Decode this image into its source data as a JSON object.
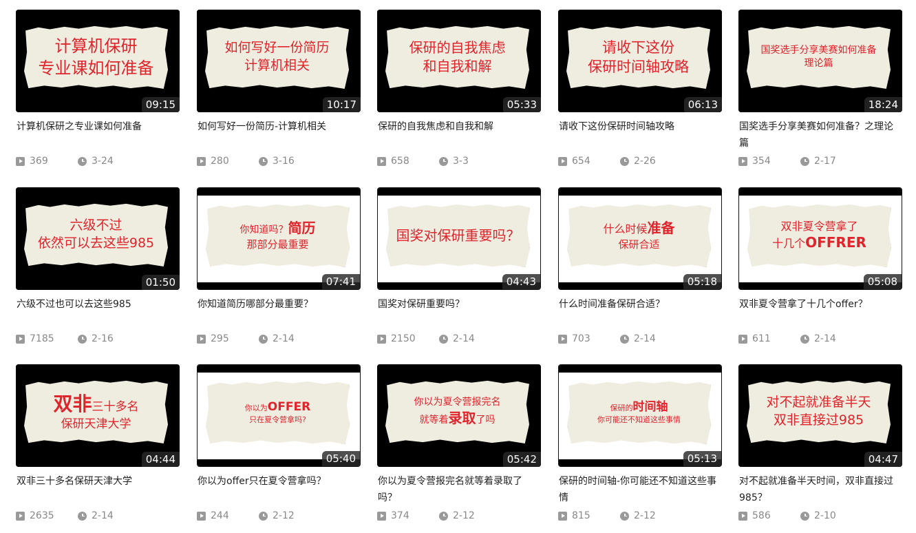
{
  "videos": [
    {
      "title": "计算机保研之专业课如何准备",
      "duration": "09:15",
      "views": "369",
      "date": "3-24",
      "thumb_lines": [
        {
          "a": "计算机保研"
        },
        {
          "a": "专业课如何准备"
        }
      ]
    },
    {
      "title": "如何写好一份简历-计算机相关",
      "duration": "10:17",
      "views": "280",
      "date": "3-16",
      "thumb_lines": [
        {
          "a": "如何写好一份简历"
        },
        {
          "a": "计算机相关"
        }
      ]
    },
    {
      "title": "保研的自我焦虑和自我和解",
      "duration": "05:33",
      "views": "658",
      "date": "3-3",
      "thumb_lines": [
        {
          "a": "保研的自我焦虑"
        },
        {
          "a": "和自我和解"
        }
      ]
    },
    {
      "title": "请收下这份保研时间轴攻略",
      "duration": "06:13",
      "views": "654",
      "date": "2-26",
      "thumb_lines": [
        {
          "a": "请收下这份"
        },
        {
          "a": "保研时间轴攻略"
        }
      ]
    },
    {
      "title": "国奖选手分享美赛如何准备？之理论篇",
      "duration": "18:24",
      "views": "354",
      "date": "2-17",
      "thumb_lines": [
        {
          "a": "国奖选手分享美赛如何准备"
        },
        {
          "a": "理论篇"
        }
      ]
    },
    {
      "title": "六级不过也可以去这些985",
      "duration": "01:50",
      "views": "7185",
      "date": "2-16",
      "thumb_lines": [
        {
          "a": "六级不过"
        },
        {
          "a": "依然可以去这些985"
        }
      ]
    },
    {
      "title": "你知道简历哪部分最重要？",
      "duration": "07:41",
      "views": "295",
      "date": "2-14",
      "thumb_lines": [
        {
          "a": "你知道吗？",
          "b": "简历"
        },
        {
          "a": "那部分最重要"
        }
      ]
    },
    {
      "title": "国奖对保研重要吗？",
      "duration": "04:43",
      "views": "2150",
      "date": "2-14",
      "thumb_lines": [
        {
          "a": "国奖对保研重要吗？"
        }
      ]
    },
    {
      "title": "什么时间准备保研合适？",
      "duration": "05:18",
      "views": "703",
      "date": "2-14",
      "thumb_lines": [
        {
          "a": "什么时候",
          "b": "准备"
        },
        {
          "a": "保研合适"
        }
      ]
    },
    {
      "title": "双非夏令营拿了十几个offer？",
      "duration": "05:08",
      "views": "611",
      "date": "2-14",
      "thumb_lines": [
        {
          "a": "双非夏令营拿了"
        },
        {
          "a": "十几个",
          "b": "OFFRER"
        }
      ]
    },
    {
      "title": "双非三十多名保研天津大学",
      "duration": "04:44",
      "views": "2635",
      "date": "2-14",
      "thumb_lines": [
        {
          "b": "双非",
          "a": "三十多名"
        },
        {
          "a": "保研天津大学"
        }
      ]
    },
    {
      "title": "你以为offer只在夏令营拿吗？",
      "duration": "05:40",
      "views": "244",
      "date": "2-12",
      "thumb_lines": [
        {
          "a": "你以为",
          "b": "OFFER"
        },
        {
          "a": "只在夏令营拿吗?"
        }
      ]
    },
    {
      "title": "你以为夏令营报完名就等着录取了吗？",
      "duration": "05:42",
      "views": "374",
      "date": "2-12",
      "thumb_lines": [
        {
          "a": "你以为夏令营报完名"
        },
        {
          "a": "就等着",
          "b": "录取",
          "c": "了吗"
        }
      ]
    },
    {
      "title": "保研的时间轴-你可能还不知道这些事情",
      "duration": "05:13",
      "views": "815",
      "date": "2-12",
      "thumb_lines": [
        {
          "a": "保研的",
          "b": "时间轴"
        },
        {
          "a": "你可能还不知道这些事情"
        }
      ]
    },
    {
      "title": "对不起就准备半天时间，双非直接过985？",
      "duration": "04:47",
      "views": "586",
      "date": "2-10",
      "thumb_lines": [
        {
          "a": "对不起就准备半天"
        },
        {
          "a": "双非直接过985"
        }
      ]
    }
  ]
}
